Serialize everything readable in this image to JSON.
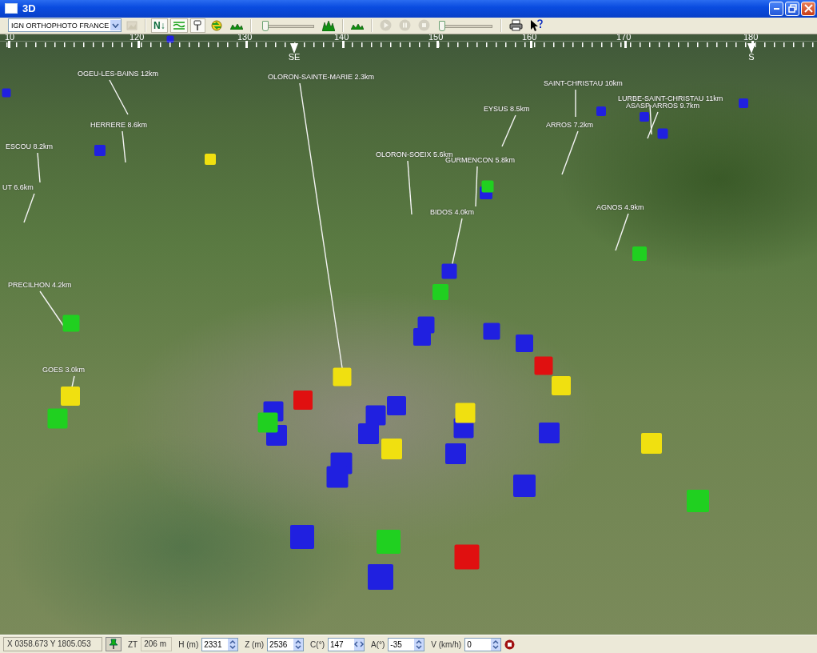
{
  "window": {
    "title": "3D"
  },
  "toolbar": {
    "layer_select": {
      "value": "IGN ORTHOPHOTO FRANCE"
    },
    "items": [
      {
        "kind": "image",
        "pressed": false,
        "disabled": true
      },
      {
        "kind": "north",
        "label": "N↓",
        "pressed": true,
        "disabled": false
      },
      {
        "kind": "hypso",
        "pressed": true,
        "disabled": false
      },
      {
        "kind": "pin",
        "pressed": true,
        "disabled": false
      },
      {
        "kind": "globe",
        "pressed": false,
        "disabled": false
      },
      {
        "kind": "terrain",
        "pressed": false,
        "disabled": false
      },
      {
        "kind": "slider",
        "level": 0.05
      },
      {
        "kind": "relief",
        "pressed": false,
        "disabled": false
      },
      {
        "kind": "terrain",
        "pressed": false,
        "disabled": false
      },
      {
        "kind": "play",
        "pressed": false,
        "disabled": true
      },
      {
        "kind": "pause",
        "pressed": false,
        "disabled": true
      },
      {
        "kind": "stop",
        "pressed": false,
        "disabled": true
      },
      {
        "kind": "slider",
        "level": 0.03
      },
      {
        "kind": "print",
        "pressed": false,
        "disabled": false
      },
      {
        "kind": "help",
        "pressed": false,
        "disabled": false
      }
    ]
  },
  "compass": {
    "ticks": [
      "10",
      "120",
      "130",
      "140",
      "150",
      "160",
      "170",
      "180"
    ],
    "directions": [
      "SE",
      "S"
    ]
  },
  "places": [
    "OGEU-LES-BAINS 12km",
    "OLORON-SAINTE-MARIE 2.3km",
    "SAINT-CHRISTAU 10km",
    "LURBE-SAINT-CHRISTAU 11km",
    "ASASP-ARROS 9.7km",
    "EYSUS 8.5km",
    "HERRERE 8.6km",
    "ARROS 7.2km",
    "ESCOU 8.2km",
    "OLORON-SOEIX 5.6km",
    "GURMENCON 5.8km",
    "UT 6.6km",
    "BIDOS 4.0km",
    "AGNOS 4.9km",
    "PRECILHON 4.2km",
    "GOES 3.0km"
  ],
  "markers": [
    {
      "color": "#2020e0"
    },
    {
      "color": "#2020e0"
    },
    {
      "color": "#2020e0"
    },
    {
      "color": "#2020e0"
    },
    {
      "color": "#2020e0"
    },
    {
      "color": "#2020e0"
    },
    {
      "color": "#2020e0"
    },
    {
      "color": "#2020e0"
    },
    {
      "color": "#2020e0"
    },
    {
      "color": "#2020e0"
    },
    {
      "color": "#2020e0"
    },
    {
      "color": "#2020e0"
    },
    {
      "color": "#2020e0"
    },
    {
      "color": "#2020e0"
    },
    {
      "color": "#2020e0"
    },
    {
      "color": "#2020e0"
    },
    {
      "color": "#2020e0"
    },
    {
      "color": "#2020e0"
    },
    {
      "color": "#2020e0"
    },
    {
      "color": "#2020e0"
    },
    {
      "color": "#2020e0"
    },
    {
      "color": "#2020e0"
    },
    {
      "color": "#2020e0"
    },
    {
      "color": "#2020e0"
    },
    {
      "color": "#2020e0"
    },
    {
      "color": "#2020e0"
    },
    {
      "color": "#20d020"
    },
    {
      "color": "#20d020"
    },
    {
      "color": "#20d020"
    },
    {
      "color": "#20d020"
    },
    {
      "color": "#20d020"
    },
    {
      "color": "#20d020"
    },
    {
      "color": "#20d020"
    },
    {
      "color": "#20d020"
    },
    {
      "color": "#f0e010"
    },
    {
      "color": "#f0e010"
    },
    {
      "color": "#f0e010"
    },
    {
      "color": "#f0e010"
    },
    {
      "color": "#f0e010"
    },
    {
      "color": "#f0e010"
    },
    {
      "color": "#f0e010"
    },
    {
      "color": "#e01010"
    },
    {
      "color": "#e01010"
    },
    {
      "color": "#e01010"
    }
  ],
  "status_bar": {
    "coordinates": "X 0358.673  Y 1805.053",
    "fields": [
      {
        "kind": "readout",
        "label": "ZT",
        "value": "206 m"
      },
      {
        "kind": "spin",
        "label": "H (m)",
        "value": "2331"
      },
      {
        "kind": "spin",
        "label": "Z (m)",
        "value": "2536"
      },
      {
        "kind": "hspin",
        "label": "C(°)",
        "value": "147"
      },
      {
        "kind": "spin",
        "label": "A(°)",
        "value": "-35"
      },
      {
        "kind": "spin",
        "label": "V (km/h)",
        "value": "0"
      }
    ]
  }
}
